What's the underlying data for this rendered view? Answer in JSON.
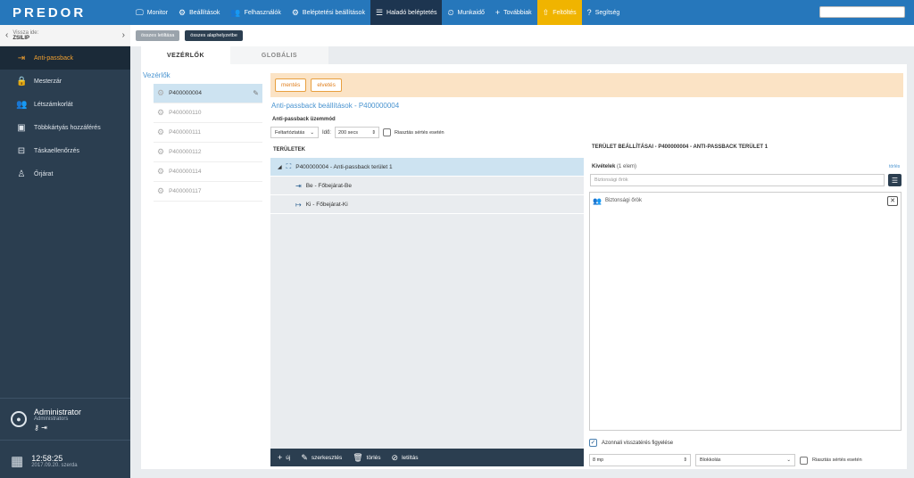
{
  "app": {
    "logo": "PREDOR"
  },
  "nav": [
    {
      "label": "Monitor",
      "icon": "monitor-icon",
      "glyph": "🖵"
    },
    {
      "label": "Beállítások",
      "icon": "gear-icon",
      "glyph": "⚙"
    },
    {
      "label": "Felhasználók",
      "icon": "users-icon",
      "glyph": "👥"
    },
    {
      "label": "Beléptetési beállítások",
      "icon": "access-icon",
      "glyph": "⚙"
    },
    {
      "label": "Haladó beléptetés",
      "icon": "sliders-icon",
      "glyph": "☰"
    },
    {
      "label": "Munkaidő",
      "icon": "clock-icon",
      "glyph": "⏲"
    },
    {
      "label": "Továbbiak",
      "icon": "plus-icon",
      "glyph": "+"
    },
    {
      "label": "Feltöltés",
      "icon": "upload-icon",
      "glyph": "⇧"
    },
    {
      "label": "Segítség",
      "icon": "help-icon",
      "glyph": "?"
    }
  ],
  "sidebar": {
    "back_label": "Vissza ide:",
    "back_target": "ZSILIP",
    "items": [
      {
        "label": "Anti-passback",
        "glyph": "⇥"
      },
      {
        "label": "Mesterzár",
        "glyph": "🔒"
      },
      {
        "label": "Létszámkorlát",
        "glyph": "👥"
      },
      {
        "label": "Többkártyás hozzáférés",
        "glyph": "▣"
      },
      {
        "label": "Táskaellenőrzés",
        "glyph": "⊟"
      },
      {
        "label": "Őrjárat",
        "glyph": "♙"
      }
    ],
    "user_name": "Administrator",
    "user_role": "Administrators",
    "time": "12:58:25",
    "date": "2017.09.20. szerda"
  },
  "toolbar": {
    "delete_all": "összes letiltása",
    "reset_all": "összes alaphelyzetbe"
  },
  "tabs": {
    "controllers": "VEZÉRLŐK",
    "global": "GLOBÁLIS"
  },
  "controllers": {
    "title": "Vezérlők",
    "items": [
      "P400000004",
      "P400000110",
      "P400000111",
      "P400000112",
      "P400000114",
      "P400000117"
    ]
  },
  "actions": {
    "save": "mentés",
    "discard": "elvetés"
  },
  "settings": {
    "title": "Anti-passback beállítások - P400000004",
    "mode_label": "Anti-passback üzemmód",
    "mode_value": "Feltartóztatás",
    "time_label": "Idő:",
    "time_value": "200 secs",
    "alarm_label": "Riasztás sértés esetén"
  },
  "areas": {
    "header": "TERÜLETEK",
    "root": "P400000004 - Anti-passback terület 1",
    "children": [
      "Be - Főbejárat-Be",
      "Ki - Főbejárat-Ki"
    ],
    "footer": {
      "new": "új",
      "edit": "szerkesztés",
      "delete": "törlés",
      "disable": "letiltás"
    }
  },
  "area_settings": {
    "title": "TERÜLET BEÁLLÍTÁSAI - P400000004 - ANTI-PASSBACK TERÜLET 1",
    "exceptions_label": "Kivételek",
    "exceptions_count": "(1 elem)",
    "clear_link": "törlés",
    "search_placeholder": "Biztonsági őrök",
    "exception_items": [
      "Biztonsági őrök"
    ],
    "immediate_label": "Azonnali visszatérés figyelése",
    "mp_value": "8 mp",
    "block_value": "Blokkolás",
    "alarm_label": "Riasztás sértés esetén"
  },
  "colors": {
    "primary": "#2677bb",
    "sidebar": "#2b3e50",
    "accent": "#f0a030",
    "highlight": "#cde3f1"
  }
}
